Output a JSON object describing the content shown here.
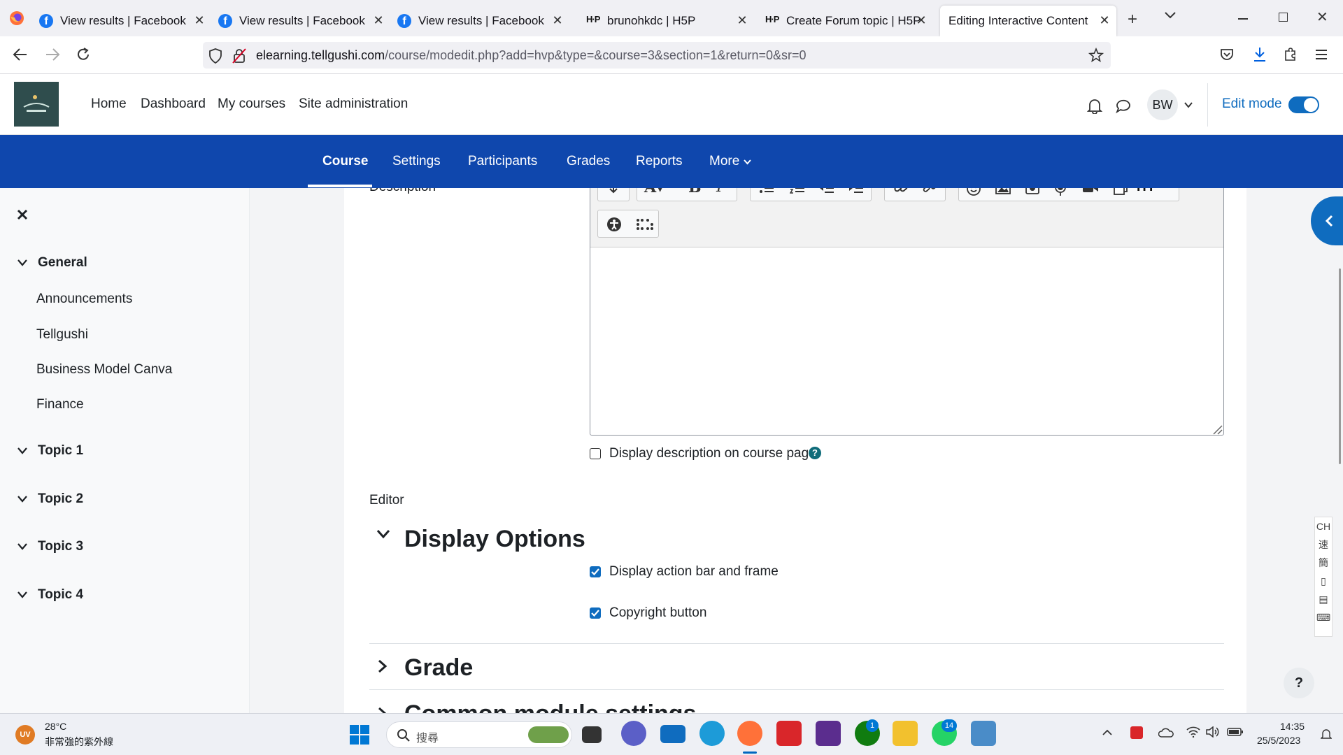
{
  "browser": {
    "tabs": [
      {
        "title": "View results | Facebook",
        "icon": "facebook-icon"
      },
      {
        "title": "View results | Facebook",
        "icon": "facebook-icon"
      },
      {
        "title": "View results | Facebook",
        "icon": "facebook-icon"
      },
      {
        "title": "brunohkdc | H5P",
        "icon": "h5p-icon"
      },
      {
        "title": "Create Forum topic | H5P",
        "icon": "h5p-icon"
      },
      {
        "title": "Editing Interactive Content",
        "icon": "",
        "active": true
      }
    ],
    "url_domain": "elearning.tellgushi.com",
    "url_prefix": "",
    "url_path": "/course/modedit.php?add=hvp&type=&course=3&section=1&return=0&sr=0"
  },
  "header": {
    "nav": [
      "Home",
      "Dashboard",
      "My courses",
      "Site administration"
    ],
    "avatar_initials": "BW",
    "edit_mode_label": "Edit mode",
    "edit_mode_on": true
  },
  "secondary_nav": {
    "items": [
      "Course",
      "Settings",
      "Participants",
      "Grades",
      "Reports",
      "More"
    ],
    "active": "Course"
  },
  "sidebar": {
    "sections": [
      {
        "title": "General",
        "expanded": true,
        "items": [
          "Announcements",
          "Tellgushi",
          "Business Model Canva",
          "Finance"
        ]
      },
      {
        "title": "Topic 1",
        "expanded": false,
        "items": []
      },
      {
        "title": "Topic 2",
        "expanded": false,
        "items": []
      },
      {
        "title": "Topic 3",
        "expanded": false,
        "items": []
      },
      {
        "title": "Topic 4",
        "expanded": false,
        "items": []
      }
    ]
  },
  "form": {
    "description_label": "Description",
    "display_description_label": "Display description on course page",
    "display_description_checked": false,
    "editor_label": "Editor",
    "display_options_heading": "Display Options",
    "action_bar_label": "Display action bar and frame",
    "action_bar_checked": true,
    "copyright_label": "Copyright button",
    "copyright_checked": true,
    "grade_heading": "Grade",
    "common_heading": "Common module settings"
  },
  "ime": {
    "items": [
      "CH",
      "速",
      "簡",
      "▯",
      "▤",
      "⌨"
    ]
  },
  "taskbar": {
    "weather_badge": "UV",
    "weather_temp": "28°C",
    "weather_desc": "非常強的紫外線",
    "search_placeholder": "搜尋",
    "clock_time": "14:35",
    "clock_date": "25/5/2023",
    "badge_xbox": "1",
    "badge_whatsapp": "14"
  },
  "colors": {
    "primary": "#0f47ad",
    "accent": "#0f6cbf",
    "sidebar_bg": "#f8f9fa",
    "main_bg": "#f3f4f6"
  }
}
